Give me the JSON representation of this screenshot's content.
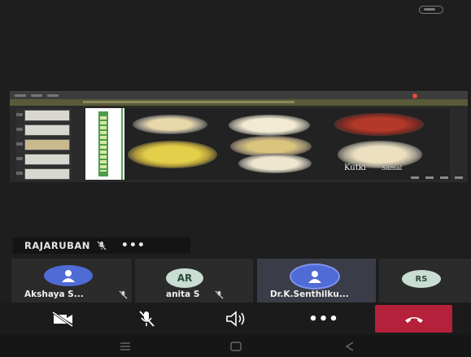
{
  "status_bar": {
    "battery_icon": "battery-icon"
  },
  "shared_screen": {
    "slide_captions": [
      "Kutki",
      "Samai"
    ],
    "icons": [
      "slide-thumbnail-icon",
      "record-icon"
    ]
  },
  "speaker": {
    "name": "RAJARUBAN",
    "mic_icon": "mic-off-icon",
    "more_label": "•••"
  },
  "participants": [
    {
      "name": "Akshaya S...",
      "initials": "",
      "avatar_color": "#4f6bd6",
      "mic": "mic-off-icon"
    },
    {
      "name": "anita S",
      "initials": "AR",
      "avatar_color": "#c9ddd3",
      "mic": "mic-off-icon"
    },
    {
      "name": "Dr.K.Senthilku...",
      "initials": "",
      "avatar_color": "#4f6bd6",
      "mic": "",
      "active": true
    },
    {
      "name": "",
      "initials": "RS",
      "avatar_color": "#c9ddd3",
      "mic": ""
    }
  ],
  "controls": {
    "video_icon": "video-off-icon",
    "mic_icon": "mic-off-icon",
    "speaker_icon": "speaker-icon",
    "more_label": "•••",
    "end_call_icon": "end-call-icon",
    "end_call_color": "#b5203a"
  },
  "navbar": {
    "icons": [
      "recents-icon",
      "home-icon",
      "back-icon"
    ]
  }
}
